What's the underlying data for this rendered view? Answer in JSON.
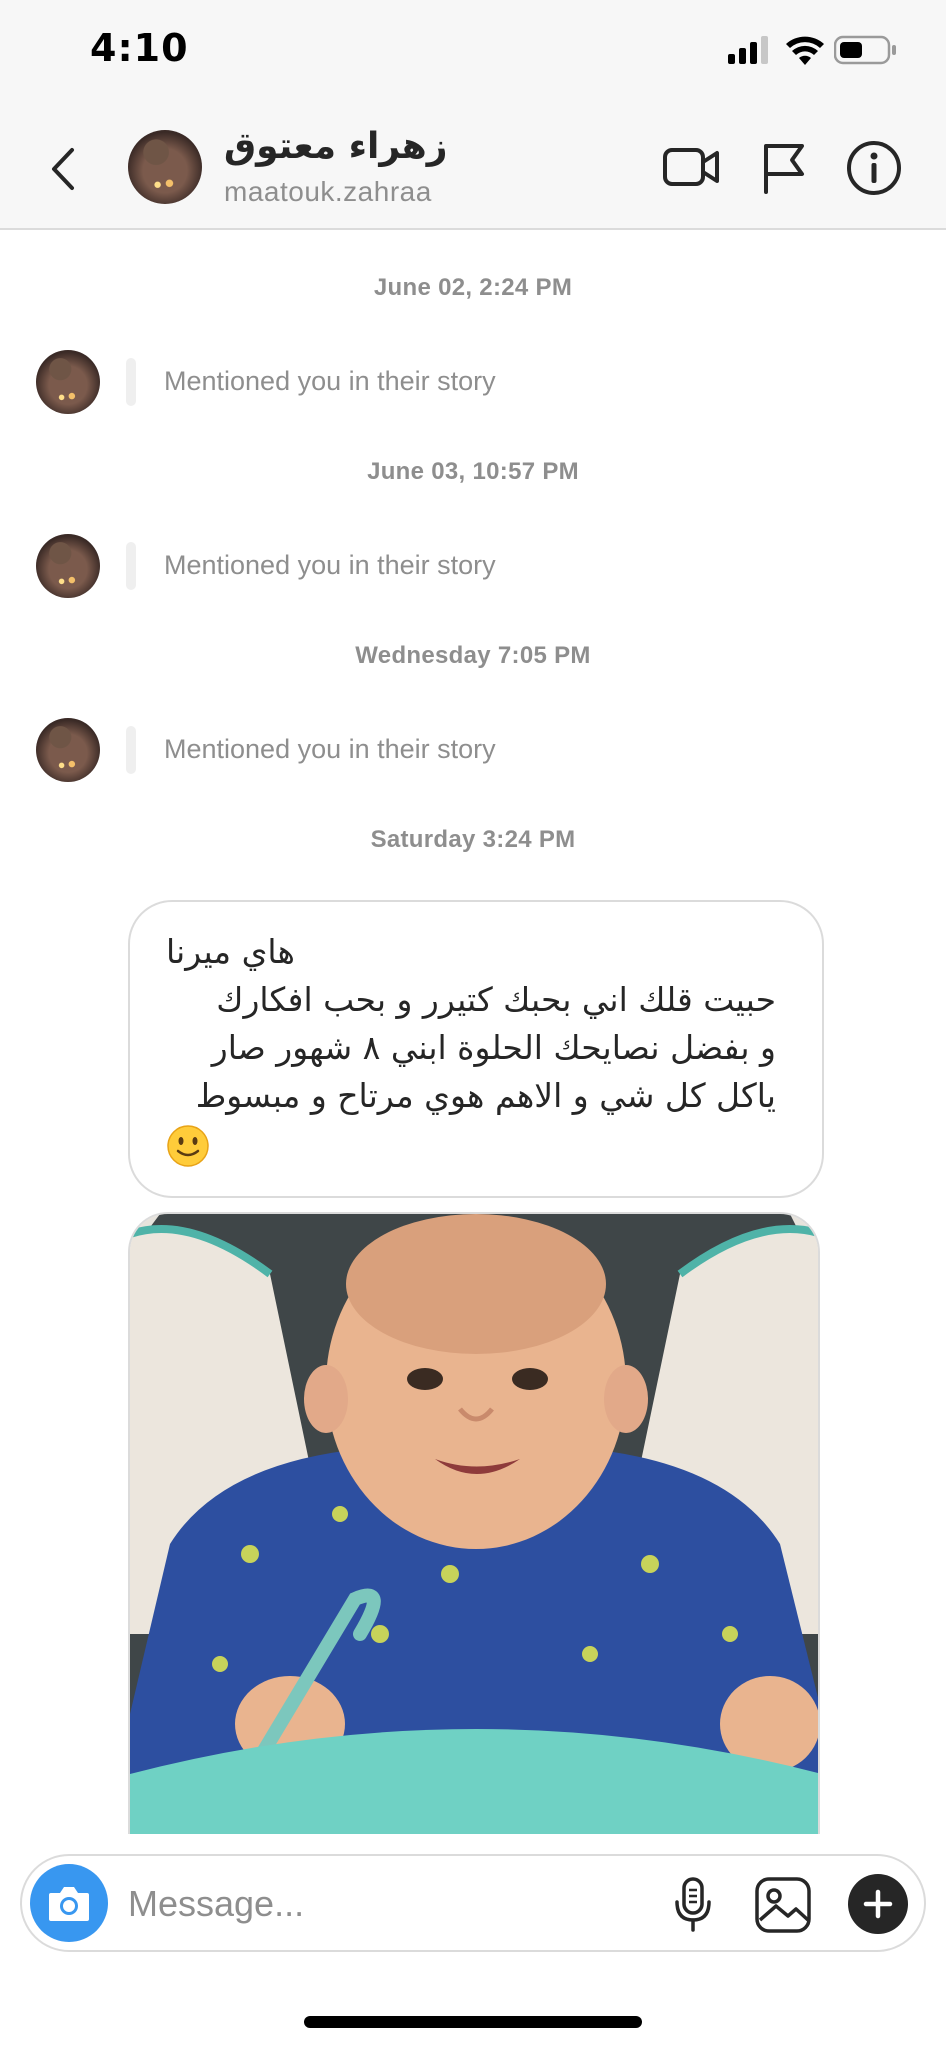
{
  "status_bar": {
    "time": "4:10"
  },
  "header": {
    "name": "زهراء معتوق",
    "username": "maatouk.zahraa",
    "icons": [
      "chevron-left-icon",
      "video-call-icon",
      "flag-icon",
      "info-icon"
    ]
  },
  "thread": {
    "timestamps": [
      "June 02, 2:24 PM",
      "June 03, 10:57 PM",
      "Wednesday 7:05 PM",
      "Saturday 3:24 PM"
    ],
    "mentions": [
      "Mentioned you in their story",
      "Mentioned you in their story",
      "Mentioned you in their story"
    ],
    "message_lines": [
      "هاي ميرنا",
      "حبيت قلك اني بحبك كتيرر و بحب افكارك",
      "و بفضل نصايحك الحلوة ابني ٨ شهور صار",
      "ياكل كل شي و الاهم هوي مرتاح و مبسوط"
    ],
    "emoji": "slightly-smiling-face",
    "photo": "baby-in-highchair-photo"
  },
  "composer": {
    "placeholder": "Message...",
    "value": ""
  },
  "colors": {
    "accent_blue": "#3897f0",
    "text_primary": "#262626",
    "text_secondary": "#8e8e8e",
    "border": "#dbdbdb"
  }
}
